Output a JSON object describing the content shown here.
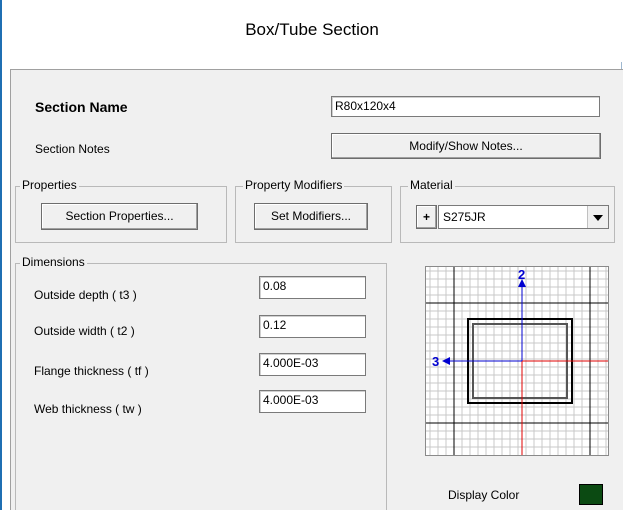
{
  "window": {
    "title": "Box/Tube Section"
  },
  "section": {
    "name_label": "Section Name",
    "name_value": "R80x120x4",
    "notes_label": "Section Notes",
    "notes_button": "Modify/Show Notes..."
  },
  "properties": {
    "group_label": "Properties",
    "button": "Section Properties..."
  },
  "modifiers": {
    "group_label": "Property Modifiers",
    "button": "Set Modifiers..."
  },
  "material": {
    "group_label": "Material",
    "plus": "+",
    "selected": "S275JR"
  },
  "dimensions": {
    "group_label": "Dimensions",
    "rows": [
      {
        "label": "Outside depth  ( t3 )",
        "value": "0.08"
      },
      {
        "label": "Outside width  ( t2 )",
        "value": "0.12"
      },
      {
        "label": "Flange thickness  ( tf )",
        "value": "4.000E-03"
      },
      {
        "label": "Web thickness  ( tw )",
        "value": "4.000E-03"
      }
    ]
  },
  "preview": {
    "axis_vertical": "2",
    "axis_horizontal": "3"
  },
  "display_color": {
    "label": "Display Color",
    "color": "#0b4a12"
  }
}
